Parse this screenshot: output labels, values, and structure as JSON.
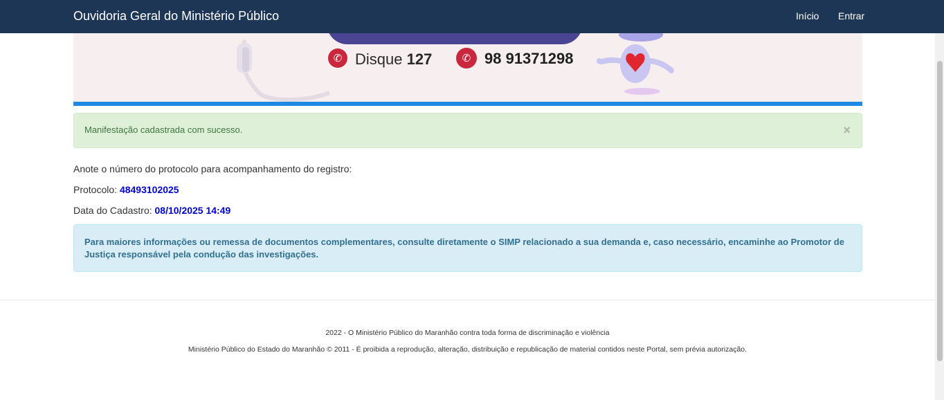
{
  "navbar": {
    "brand": "Ouvidoria Geral do Ministério Público",
    "links": [
      {
        "label": "Início"
      },
      {
        "label": "Entrar"
      }
    ]
  },
  "banner": {
    "disque_label": "Disque",
    "disque_number": "127",
    "whatsapp_number": "98 91371298",
    "icons": [
      "phone-icon",
      "whatsapp-icon",
      "headset-icon",
      "mascot-robot-icon"
    ],
    "colors": {
      "background": "#f7eeef",
      "accent": "#c8273d",
      "line": "#1e88e5"
    }
  },
  "success_alert": {
    "message": "Manifestação cadastrada com sucesso.",
    "close_label": "×"
  },
  "record": {
    "instruction": "Anote o número do protocolo para acompanhamento do registro:",
    "protocol_label": "Protocolo:",
    "protocol_value": "48493102025",
    "date_label": "Data do Cadastro:",
    "date_value": "08/10/2025 14:49"
  },
  "info_alert": {
    "message": "Para maiores informações ou remessa de documentos complementares, consulte diretamente o SIMP relacionado a sua demanda e, caso necessário, encaminhe ao Promotor de Justiça responsável pela condução das investigações."
  },
  "footer": {
    "line1": "2022 - O Ministério Público do Maranhão contra toda forma de discriminação e violência",
    "line2": "Ministério Público do Estado do Maranhão © 2011 - É proibida a reprodução, alteração, distribuição e republicação de material contidos neste Portal, sem prévia autorização."
  }
}
